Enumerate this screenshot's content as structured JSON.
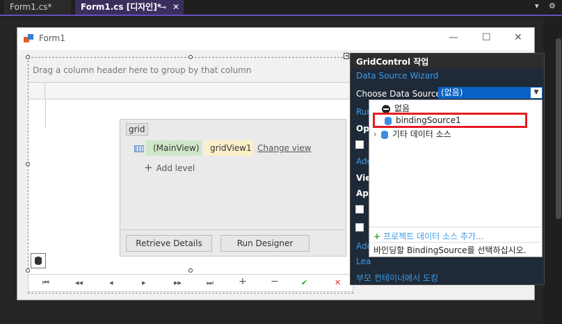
{
  "tabs": [
    {
      "label": "Form1.cs*"
    },
    {
      "label": "Form1.cs [디자인]*"
    }
  ],
  "tab_icons": {
    "pin": "⊸",
    "close": "✕",
    "dropdown": "▾",
    "settings": "⚙"
  },
  "form": {
    "title": "Form1",
    "controls": {
      "minimize": "—",
      "maximize": "☐",
      "close": "✕"
    }
  },
  "grid": {
    "group_panel_text": "Drag a column header here to group by that column",
    "level_designer": {
      "tag": "grid",
      "main_view": "(MainView)",
      "grid_view": "gridView1",
      "change_view": "Change view",
      "add_level": "Add level",
      "retrieve_details": "Retrieve Details",
      "run_designer": "Run Designer"
    },
    "navigator": [
      "⏮",
      "◂◂",
      "◂",
      "▸",
      "▸▸",
      "⏭",
      "+",
      "−",
      "✔",
      "✕"
    ]
  },
  "smart_panel": {
    "title": "GridControl 작업",
    "wizard_link": "Data Source Wizard",
    "choose_label": "Choose Data Source",
    "selected_value": "(없음)",
    "fragments": [
      "Run",
      "Op",
      "Add",
      "Vie",
      "Ap",
      "Add",
      "Lea",
      "부모 컨테이너에서 도킹"
    ]
  },
  "dropdown": {
    "items": [
      "없음",
      "bindingSource1",
      "기타 데이터 소스"
    ],
    "add_link": "프로젝트 데이터 소스 추가...",
    "description": "바인딩할 BindingSource를 선택하십시오."
  }
}
